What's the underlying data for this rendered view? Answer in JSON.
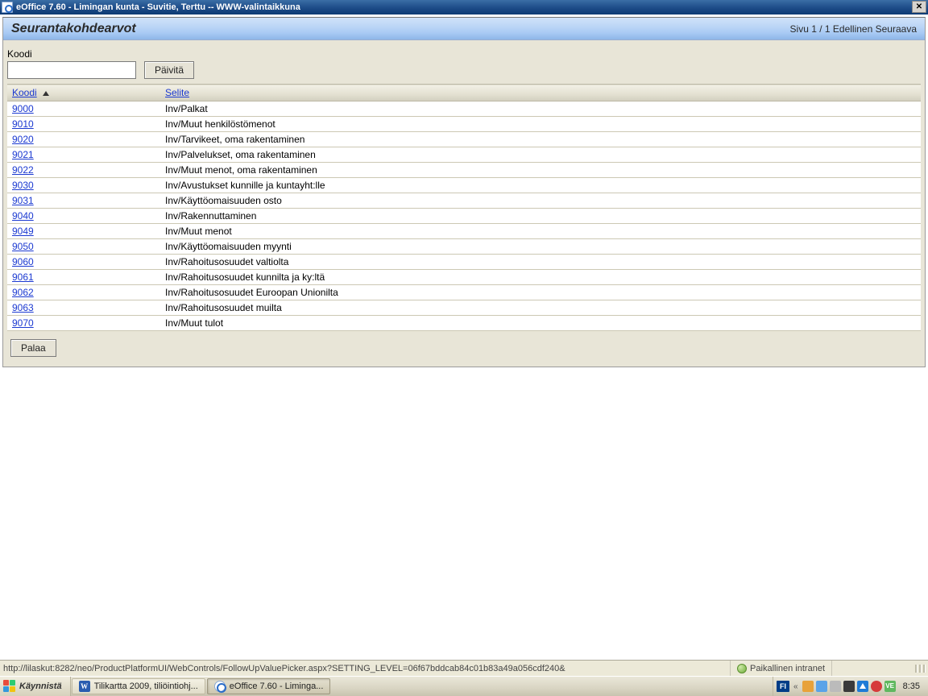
{
  "window": {
    "title": "eOffice 7.60 - Limingan kunta - Suvitie, Terttu -- WWW-valintaikkuna"
  },
  "header": {
    "page_title": "Seurantakohdearvot",
    "page_info": "Sivu 1 / 1",
    "prev_label": "Edellinen",
    "next_label": "Seuraava"
  },
  "filter": {
    "koodi_label": "Koodi",
    "koodi_value": "",
    "refresh_btn": "Päivitä"
  },
  "columns": {
    "koodi": "Koodi",
    "selite": "Selite"
  },
  "rows": [
    {
      "koodi": "9000",
      "selite": "Inv/Palkat"
    },
    {
      "koodi": "9010",
      "selite": "Inv/Muut henkilöstömenot"
    },
    {
      "koodi": "9020",
      "selite": "Inv/Tarvikeet, oma rakentaminen"
    },
    {
      "koodi": "9021",
      "selite": "Inv/Palvelukset, oma rakentaminen"
    },
    {
      "koodi": "9022",
      "selite": "Inv/Muut menot, oma rakentaminen"
    },
    {
      "koodi": "9030",
      "selite": "Inv/Avustukset kunnille ja kuntayht:lle"
    },
    {
      "koodi": "9031",
      "selite": "Inv/Käyttöomaisuuden osto"
    },
    {
      "koodi": "9040",
      "selite": "Inv/Rakennuttaminen"
    },
    {
      "koodi": "9049",
      "selite": "Inv/Muut menot"
    },
    {
      "koodi": "9050",
      "selite": "Inv/Käyttöomaisuuden myynti"
    },
    {
      "koodi": "9060",
      "selite": "Inv/Rahoitusosuudet valtiolta"
    },
    {
      "koodi": "9061",
      "selite": "Inv/Rahoitusosuudet kunnilta ja ky:ltä"
    },
    {
      "koodi": "9062",
      "selite": "Inv/Rahoitusosuudet Euroopan Unionilta"
    },
    {
      "koodi": "9063",
      "selite": "Inv/Rahoitusosuudet muilta"
    },
    {
      "koodi": "9070",
      "selite": "Inv/Muut tulot"
    }
  ],
  "footer": {
    "back_btn": "Palaa"
  },
  "statusbar": {
    "url": "http://lilaskut:8282/neo/ProductPlatformUI/WebControls/FollowUpValuePicker.aspx?SETTING_LEVEL=06f67bddcab84c01b83a49a056cdf240&",
    "zone": "Paikallinen intranet"
  },
  "taskbar": {
    "start": "Käynnistä",
    "task1": "Tilikartta 2009, tiliöintiohj...",
    "task2": "eOffice 7.60 - Liminga...",
    "lang": "FI",
    "t7_label": "VE",
    "clock": "8:35"
  }
}
